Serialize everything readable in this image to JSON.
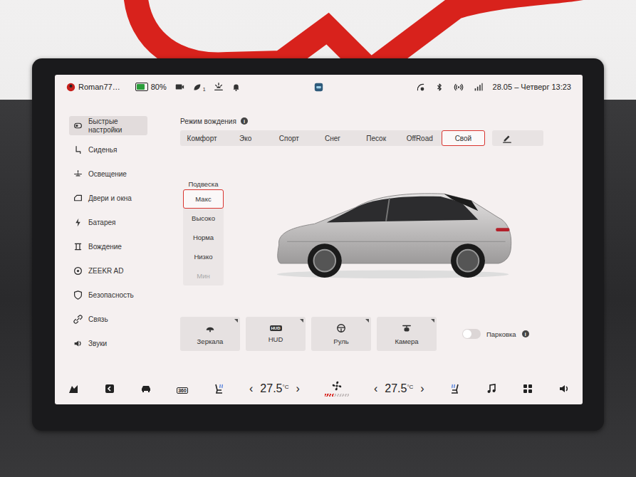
{
  "status_bar": {
    "user": "Roman77…",
    "battery": "80%",
    "battery_level": 0.8,
    "badge": "1",
    "datetime": "28.05 – Четверг 13:23"
  },
  "sidebar": {
    "items": [
      {
        "label": "Быстрые настройки",
        "selected": true
      },
      {
        "label": "Сиденья",
        "selected": false
      },
      {
        "label": "Освещение",
        "selected": false
      },
      {
        "label": "Двери и окна",
        "selected": false
      },
      {
        "label": "Батарея",
        "selected": false
      },
      {
        "label": "Вождение",
        "selected": false
      },
      {
        "label": "ZEEKR AD",
        "selected": false
      },
      {
        "label": "Безопасность",
        "selected": false
      },
      {
        "label": "Связь",
        "selected": false
      },
      {
        "label": "Звуки",
        "selected": false
      }
    ]
  },
  "drive_mode": {
    "title": "Режим вождения",
    "info": "i",
    "modes": [
      {
        "label": "Комфорт",
        "selected": false
      },
      {
        "label": "Эко",
        "selected": false
      },
      {
        "label": "Спорт",
        "selected": false
      },
      {
        "label": "Снег",
        "selected": false
      },
      {
        "label": "Песок",
        "selected": false
      },
      {
        "label": "OffRoad",
        "selected": false
      },
      {
        "label": "Свой",
        "selected": true
      }
    ]
  },
  "suspension": {
    "title": "Подвеска",
    "options": [
      {
        "label": "Макс",
        "selected": true,
        "disabled": false
      },
      {
        "label": "Высоко",
        "selected": false,
        "disabled": false
      },
      {
        "label": "Норма",
        "selected": false,
        "disabled": false
      },
      {
        "label": "Низко",
        "selected": false,
        "disabled": false
      },
      {
        "label": "Мин",
        "selected": false,
        "disabled": true
      }
    ]
  },
  "quick_buttons": [
    {
      "label": "Зеркала"
    },
    {
      "label": "HUD",
      "icon_text": "HUD"
    },
    {
      "label": "Руль"
    },
    {
      "label": "Камера"
    }
  ],
  "parking": {
    "label": "Парковка",
    "info": "i",
    "on": false
  },
  "dock": {
    "view_label": "360"
  },
  "climate": {
    "left": {
      "prev": "‹",
      "value": "27.5",
      "unit": "°C",
      "next": "›"
    },
    "right": {
      "prev": "‹",
      "value": "27.5",
      "unit": "°C",
      "next": "›"
    },
    "fan_level": 0.4
  }
}
